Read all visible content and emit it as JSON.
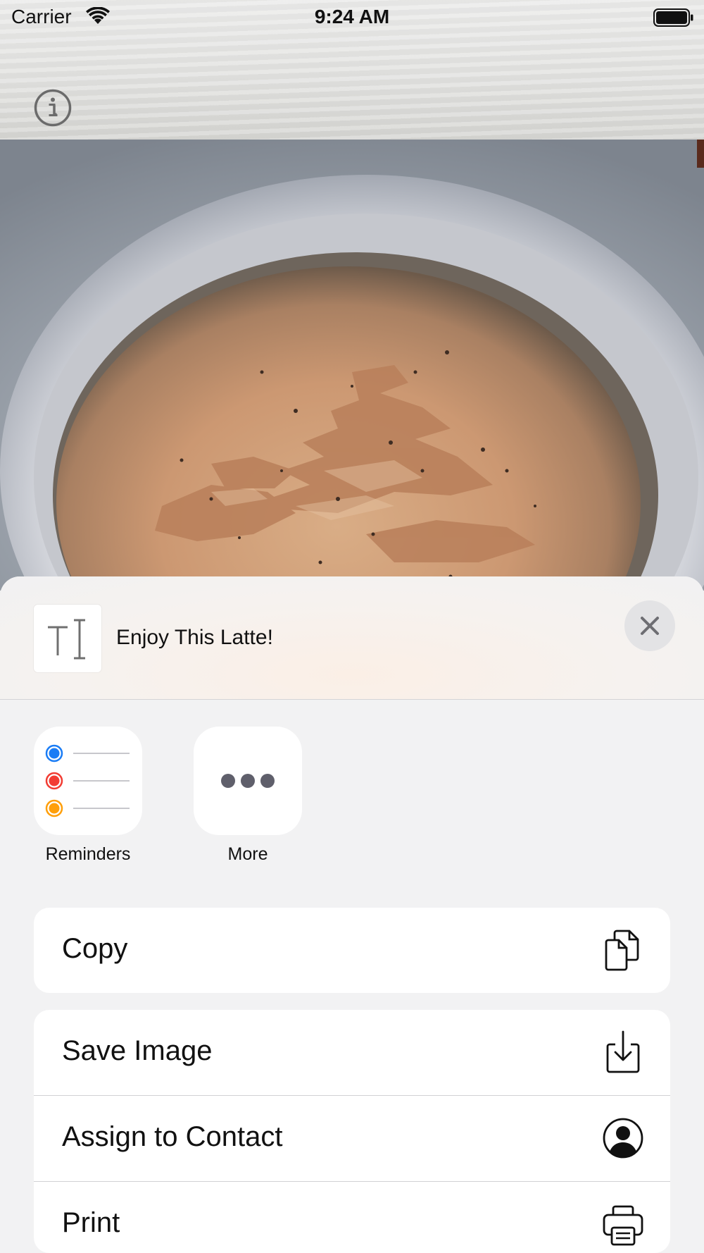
{
  "status_bar": {
    "carrier": "Carrier",
    "time": "9:24 AM"
  },
  "toolbar": {
    "info_icon": "info-circle-icon"
  },
  "share_sheet": {
    "title": "Enjoy This Latte!",
    "close_icon": "xmark-icon",
    "apps": [
      {
        "label": "Reminders",
        "icon": "reminders-app-icon"
      },
      {
        "label": "More",
        "icon": "more-ellipsis-icon"
      }
    ],
    "actions_primary": [
      {
        "label": "Copy",
        "icon": "copy-documents-icon"
      }
    ],
    "actions_secondary": [
      {
        "label": "Save Image",
        "icon": "save-download-icon"
      },
      {
        "label": "Assign to Contact",
        "icon": "person-circle-icon"
      },
      {
        "label": "Print",
        "icon": "printer-icon"
      }
    ]
  },
  "colors": {
    "sheet_background": "#f2f2f3",
    "reminder_blue": "#1a7cf5",
    "reminder_red": "#f23c33",
    "reminder_orange": "#ff9f0a"
  }
}
